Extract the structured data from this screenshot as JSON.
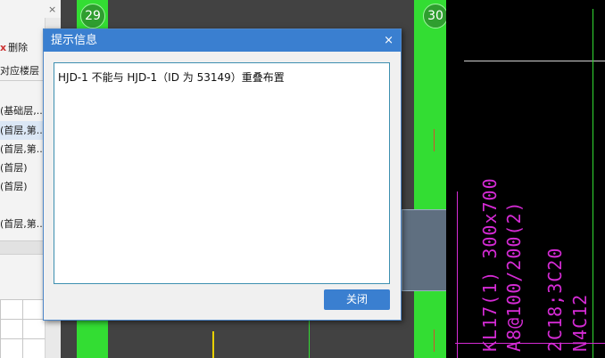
{
  "left_panel": {
    "close_label": "×",
    "delete_label": "删除",
    "column_header": "对应楼层",
    "rows": [
      "(基础层,...",
      "(首层,第...",
      "(首层,第...",
      "(首层)",
      "(首层)",
      "",
      "(首层,第..."
    ]
  },
  "canvas": {
    "axis_left": "29",
    "axis_right": "30"
  },
  "cad_labels": {
    "line1": "KL17(1) 300x700",
    "line2": "A8@100/200(2)",
    "line3": "2C18;3C20",
    "line4": "N4C12"
  },
  "dialog": {
    "title": "提示信息",
    "close_icon": "×",
    "message": "HJD-1 不能与 HJD-1（ID 为 53149）重叠布置",
    "ok_label": "关闭"
  },
  "colors": {
    "dialog_title_bg": "#3a7fd0",
    "column_green": "#33dd33",
    "cad_magenta": "#d52bd5"
  }
}
